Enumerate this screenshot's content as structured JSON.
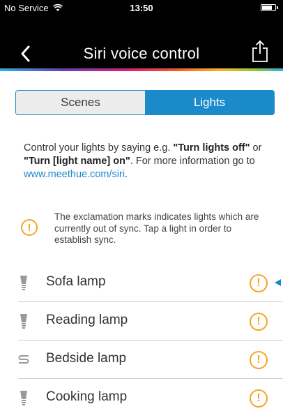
{
  "status_bar": {
    "carrier": "No Service",
    "time": "13:50"
  },
  "nav": {
    "title": "Siri voice control"
  },
  "tabs": [
    {
      "label": "Scenes",
      "active": false
    },
    {
      "label": "Lights",
      "active": true
    }
  ],
  "info": {
    "part1": "Control your lights by saying e.g. ",
    "example1": "\"Turn lights off\"",
    "part2": " or ",
    "example2": "\"Turn [light name] on\"",
    "part3": ". For more information go to ",
    "link": "www.meethue.com/siri",
    "part4": "."
  },
  "sync_note": {
    "icon": "!",
    "text": "The exclamation marks indicates lights which are currently out of sync. Tap a light in order to establish sync."
  },
  "lights": [
    {
      "name": "Sofa lamp",
      "icon": "bulb-icon",
      "out_of_sync": true,
      "selected": true
    },
    {
      "name": "Reading lamp",
      "icon": "bulb-icon",
      "out_of_sync": true,
      "selected": false
    },
    {
      "name": "Bedside lamp",
      "icon": "lightstrip-icon",
      "out_of_sync": true,
      "selected": false
    },
    {
      "name": "Cooking lamp",
      "icon": "bulb-icon",
      "out_of_sync": true,
      "selected": false
    }
  ],
  "colors": {
    "accent": "#1a8acb",
    "warning": "#f5a623"
  }
}
